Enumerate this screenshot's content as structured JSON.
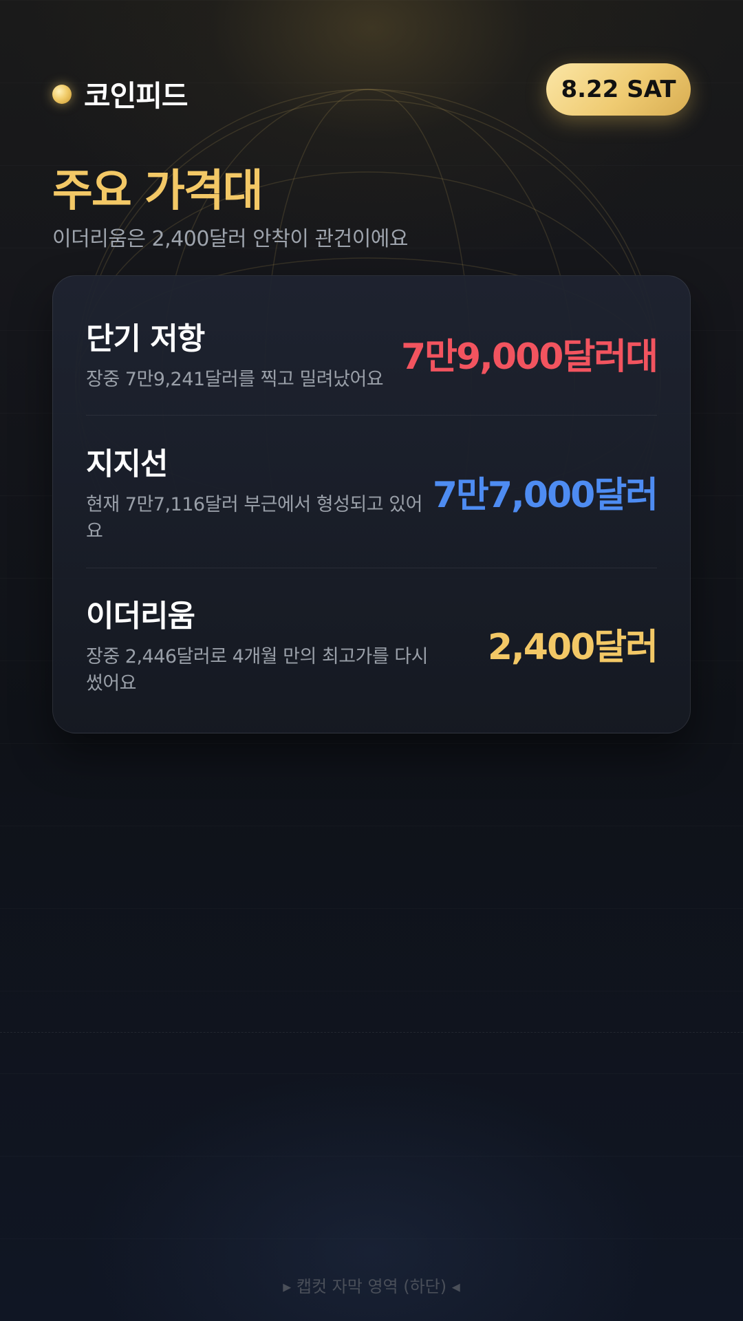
{
  "header": {
    "brand_name": "코인피드",
    "date": "8.22 SAT"
  },
  "main": {
    "title": "주요 가격대",
    "subtitle": "이더리움은 2,400달러 안착이 관건이에요"
  },
  "price_levels": [
    {
      "title": "단기 저항",
      "description": "장중 7만9,241달러를 찍고 밀려났어요",
      "value": "7만9,000달러대",
      "color": "#f2545f"
    },
    {
      "title": "지지선",
      "description": "현재 7만7,116달러 부근에서 형성되고 있어요",
      "value": "7만7,000달러",
      "color": "#4e8cf2"
    },
    {
      "title": "이더리움",
      "description": "장중 2,446달러로 4개월 만의 최고가를 다시 썼어요",
      "value": "2,400달러",
      "color": "#f3c866"
    }
  ],
  "footer": {
    "caption_placeholder": "▸ 캡컷 자막 영역 (하단) ◂"
  },
  "colors": {
    "accent_gold": "#f3c866",
    "resistance_red": "#f2545f",
    "support_blue": "#4e8cf2",
    "background": "#0f1218"
  }
}
